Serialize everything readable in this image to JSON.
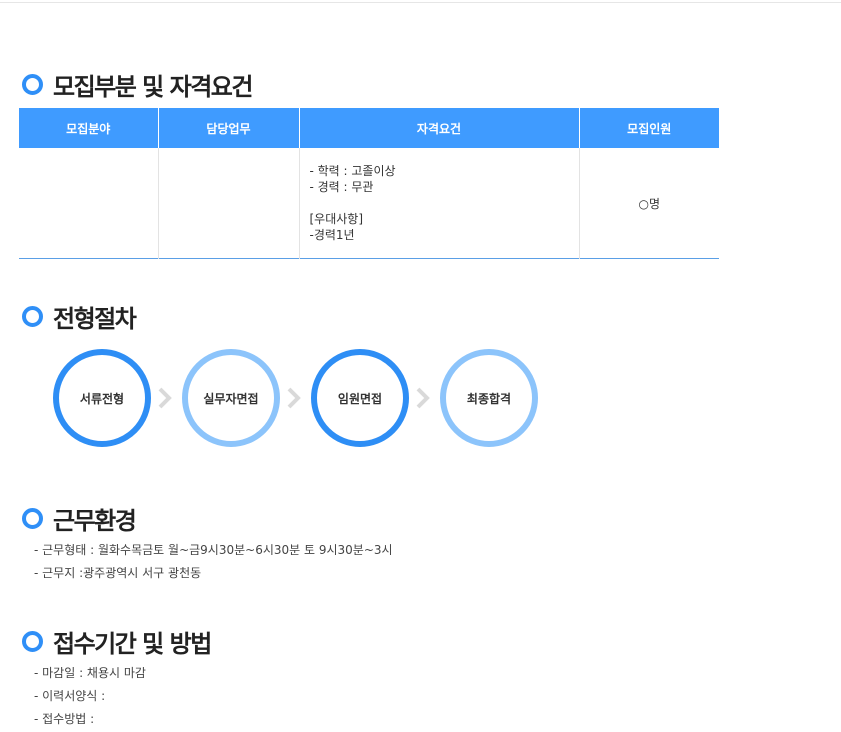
{
  "sections": {
    "recruit": "모집부분 및 자격요건",
    "process": "전형절차",
    "environment": "근무환경",
    "apply": "접수기간 및 방법"
  },
  "table": {
    "headers": [
      "모집분야",
      "담당업무",
      "자격요건",
      "모집인원"
    ],
    "row": {
      "field": "",
      "duty": "",
      "qualifications": [
        "- 학력 : 고졸이상",
        "- 경력 : 무관"
      ],
      "preferred": [
        "[우대사항]",
        "-경력1년"
      ],
      "count": "○명"
    }
  },
  "steps": [
    {
      "label": "서류전형",
      "style": "dark"
    },
    {
      "label": "실무자면접",
      "style": "light"
    },
    {
      "label": "임원면접",
      "style": "dark"
    },
    {
      "label": "최종합격",
      "style": "light"
    }
  ],
  "environment": {
    "items": [
      "- 근무형태 : 월화수목금토 월~금9시30분~6시30분 토 9시30분~3시",
      "- 근무지 :광주광역시 서구 광천동"
    ]
  },
  "apply": {
    "items": [
      "- 마감일 : 채용시 마감",
      "- 이력서양식 :",
      "- 접수방법 :"
    ]
  },
  "colors": {
    "accent": "#2f8ff7",
    "header_bg": "#3f9bff",
    "light_ring": "#8cc4fb",
    "chevron": "#d9d9d9"
  },
  "icons": {
    "section_marker": "ring-bullet-icon",
    "step_separator": "chevron-right-icon"
  }
}
